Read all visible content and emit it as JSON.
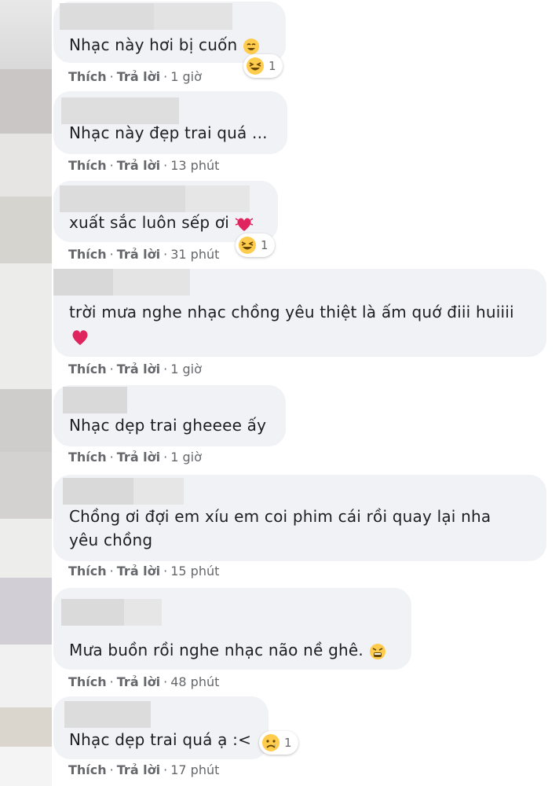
{
  "actions": {
    "like": "Thích",
    "reply": "Trả lời",
    "separator": "·"
  },
  "comments": [
    {
      "text": "Nhạc này hơi bị cuốn",
      "time": "1 giờ",
      "reaction_count": "1"
    },
    {
      "text": "Nhạc này đẹp trai quá ...",
      "time": "13 phút"
    },
    {
      "text": "xuất sắc luôn sếp ơi",
      "time": "31 phút",
      "reaction_count": "1"
    },
    {
      "text_line1": "trời mưa nghe nhạc chồng yêu thiệt là ấm quớ điii huiiii",
      "time": "1 giờ"
    },
    {
      "text": "Nhạc dẹp trai gheeee ấy",
      "time": "1 giờ"
    },
    {
      "text_line1": "Chồng ơi đợi em xíu em coi phim cái rồi quay lại nha",
      "text_line2": "yêu chồng",
      "time": "15 phút"
    },
    {
      "text": "Mưa buồn rồi nghe nhạc não nề ghê.",
      "time": "48 phút"
    },
    {
      "text": "Nhạc dẹp trai quá ạ :<",
      "time": "17 phút",
      "reaction_count": "1"
    }
  ],
  "icons": {
    "smile": "grinning-face-icon",
    "laugh": "laughing-face-icon",
    "heart_pulse": "beating-heart-icon",
    "heart": "red-heart-icon",
    "tired": "tired-face-icon",
    "sad": "sad-face-icon"
  },
  "colors": {
    "bubble": "#f0f2f5",
    "meta_text": "#65676b",
    "heart": "#e0245e",
    "emoji_yellow": "#ffcc4d"
  }
}
